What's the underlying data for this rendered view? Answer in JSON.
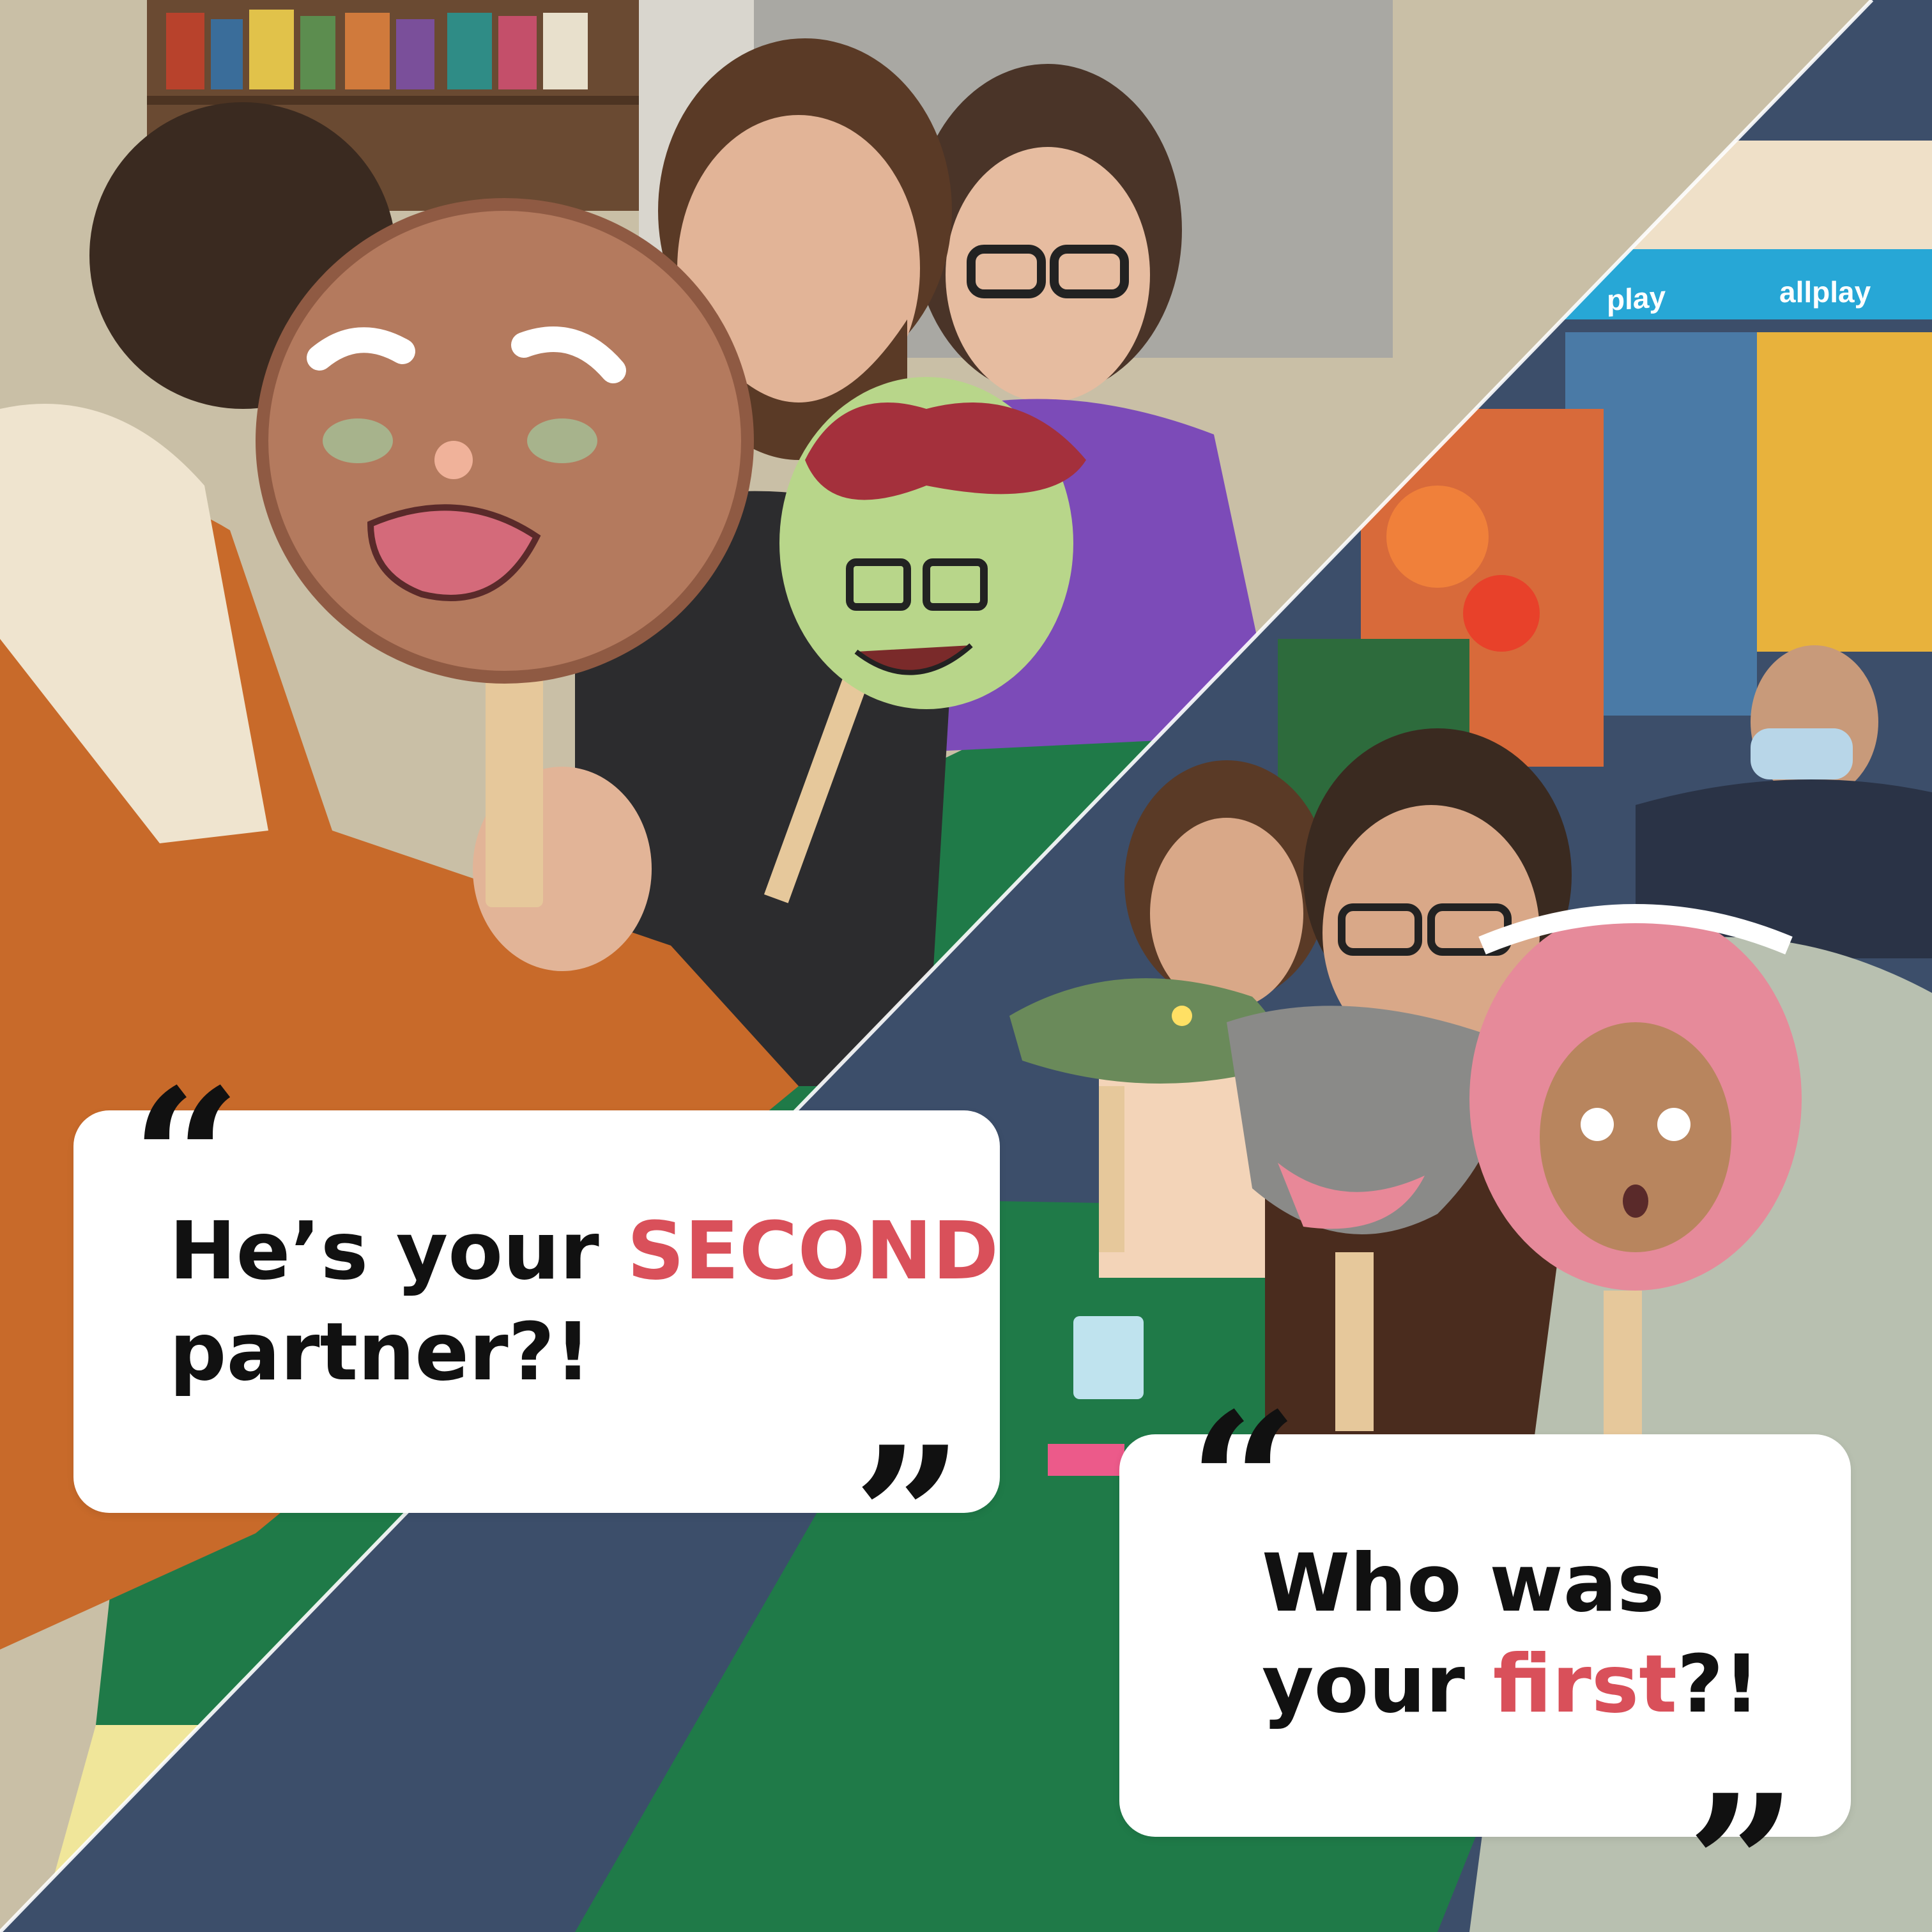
{
  "caption_left": {
    "line1_prefix": "He’s your ",
    "line1_highlight": "SECOND",
    "line2": "partner?!"
  },
  "caption_right": {
    "line1": "Who was",
    "line2_prefix": "your ",
    "line2_highlight": "first",
    "line2_suffix": "?!"
  },
  "quote_marks": {
    "open": "“",
    "close": "”"
  },
  "background_signage": {
    "brand_left": "play",
    "brand_right": "allplay"
  },
  "colors": {
    "highlight": "#d9505a",
    "text": "#111111",
    "bubble": "#ffffff",
    "table_felt": "#1f7a48"
  }
}
